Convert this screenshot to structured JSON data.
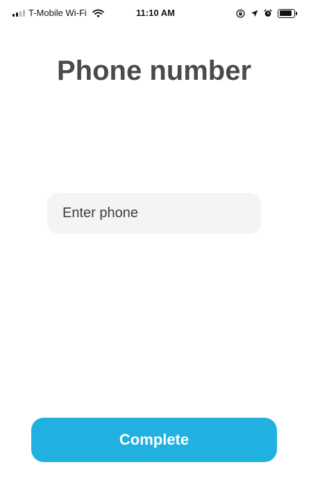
{
  "status_bar": {
    "carrier": "T-Mobile Wi-Fi",
    "time": "11:10 AM",
    "signal_bars_filled": 2,
    "signal_bars_total": 4,
    "battery_level": 0.85,
    "icons": [
      "signal-icon",
      "wifi-icon",
      "orientation-lock-icon",
      "location-arrow-icon",
      "alarm-icon",
      "battery-icon"
    ]
  },
  "page": {
    "title": "Phone number"
  },
  "phone_field": {
    "value": "",
    "placeholder": "Enter phone"
  },
  "actions": {
    "complete_label": "Complete"
  },
  "colors": {
    "accent": "#21b1e0",
    "title_text": "#4a4a4a",
    "input_background": "#f4f4f4",
    "background": "#ffffff"
  }
}
